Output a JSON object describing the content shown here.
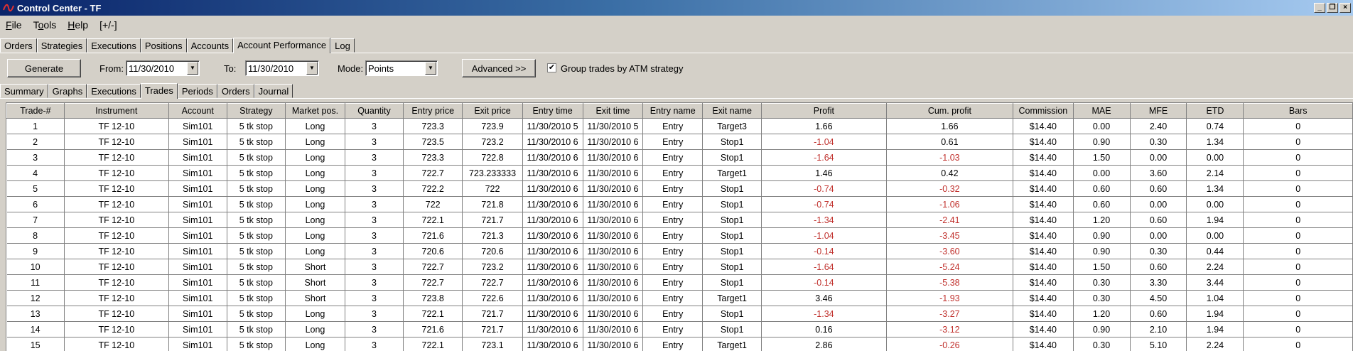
{
  "window": {
    "title": "Control Center - TF",
    "controls": [
      "_",
      "❒",
      "×"
    ]
  },
  "menu": [
    {
      "pre": "",
      "ul": "F",
      "post": "ile"
    },
    {
      "pre": "T",
      "ul": "o",
      "post": "ols"
    },
    {
      "pre": "",
      "ul": "H",
      "post": "elp"
    },
    {
      "pre": "",
      "ul": "",
      "post": "[+/-]"
    }
  ],
  "main_tabs": [
    "Orders",
    "Strategies",
    "Executions",
    "Positions",
    "Accounts",
    "Account Performance",
    "Log"
  ],
  "main_tab_active": 5,
  "toolbar": {
    "generate_label": "Generate",
    "from_label": "From:",
    "from_value": "11/30/2010",
    "to_label": "To:",
    "to_value": "11/30/2010",
    "mode_label": "Mode:",
    "mode_value": "Points",
    "advanced_label": "Advanced >>",
    "group_checked": true,
    "group_label": "Group trades by ATM strategy"
  },
  "sub_tabs": [
    "Summary",
    "Graphs",
    "Executions",
    "Trades",
    "Periods",
    "Orders",
    "Journal"
  ],
  "sub_tab_active": 3,
  "table": {
    "columns": [
      "Trade-#",
      "Instrument",
      "Account",
      "Strategy",
      "Market pos.",
      "Quantity",
      "Entry price",
      "Exit price",
      "Entry time",
      "Exit time",
      "Entry name",
      "Exit name",
      "Profit",
      "Cum. profit",
      "Commission",
      "MAE",
      "MFE",
      "ETD",
      "Bars"
    ],
    "rows": [
      [
        "1",
        "TF 12-10",
        "Sim101",
        "5 tk stop",
        "Long",
        "3",
        "723.3",
        "723.9",
        "11/30/2010 5",
        "11/30/2010 5",
        "Entry",
        "Target3",
        "1.66",
        "1.66",
        "$14.40",
        "0.00",
        "2.40",
        "0.74",
        "0"
      ],
      [
        "2",
        "TF 12-10",
        "Sim101",
        "5 tk stop",
        "Long",
        "3",
        "723.5",
        "723.2",
        "11/30/2010 6",
        "11/30/2010 6",
        "Entry",
        "Stop1",
        "-1.04",
        "0.61",
        "$14.40",
        "0.90",
        "0.30",
        "1.34",
        "0"
      ],
      [
        "3",
        "TF 12-10",
        "Sim101",
        "5 tk stop",
        "Long",
        "3",
        "723.3",
        "722.8",
        "11/30/2010 6",
        "11/30/2010 6",
        "Entry",
        "Stop1",
        "-1.64",
        "-1.03",
        "$14.40",
        "1.50",
        "0.00",
        "0.00",
        "0"
      ],
      [
        "4",
        "TF 12-10",
        "Sim101",
        "5 tk stop",
        "Long",
        "3",
        "722.7",
        "723.233333",
        "11/30/2010 6",
        "11/30/2010 6",
        "Entry",
        "Target1",
        "1.46",
        "0.42",
        "$14.40",
        "0.00",
        "3.60",
        "2.14",
        "0"
      ],
      [
        "5",
        "TF 12-10",
        "Sim101",
        "5 tk stop",
        "Long",
        "3",
        "722.2",
        "722",
        "11/30/2010 6",
        "11/30/2010 6",
        "Entry",
        "Stop1",
        "-0.74",
        "-0.32",
        "$14.40",
        "0.60",
        "0.60",
        "1.34",
        "0"
      ],
      [
        "6",
        "TF 12-10",
        "Sim101",
        "5 tk stop",
        "Long",
        "3",
        "722",
        "721.8",
        "11/30/2010 6",
        "11/30/2010 6",
        "Entry",
        "Stop1",
        "-0.74",
        "-1.06",
        "$14.40",
        "0.60",
        "0.00",
        "0.00",
        "0"
      ],
      [
        "7",
        "TF 12-10",
        "Sim101",
        "5 tk stop",
        "Long",
        "3",
        "722.1",
        "721.7",
        "11/30/2010 6",
        "11/30/2010 6",
        "Entry",
        "Stop1",
        "-1.34",
        "-2.41",
        "$14.40",
        "1.20",
        "0.60",
        "1.94",
        "0"
      ],
      [
        "8",
        "TF 12-10",
        "Sim101",
        "5 tk stop",
        "Long",
        "3",
        "721.6",
        "721.3",
        "11/30/2010 6",
        "11/30/2010 6",
        "Entry",
        "Stop1",
        "-1.04",
        "-3.45",
        "$14.40",
        "0.90",
        "0.00",
        "0.00",
        "0"
      ],
      [
        "9",
        "TF 12-10",
        "Sim101",
        "5 tk stop",
        "Long",
        "3",
        "720.6",
        "720.6",
        "11/30/2010 6",
        "11/30/2010 6",
        "Entry",
        "Stop1",
        "-0.14",
        "-3.60",
        "$14.40",
        "0.90",
        "0.30",
        "0.44",
        "0"
      ],
      [
        "10",
        "TF 12-10",
        "Sim101",
        "5 tk stop",
        "Short",
        "3",
        "722.7",
        "723.2",
        "11/30/2010 6",
        "11/30/2010 6",
        "Entry",
        "Stop1",
        "-1.64",
        "-5.24",
        "$14.40",
        "1.50",
        "0.60",
        "2.24",
        "0"
      ],
      [
        "11",
        "TF 12-10",
        "Sim101",
        "5 tk stop",
        "Short",
        "3",
        "722.7",
        "722.7",
        "11/30/2010 6",
        "11/30/2010 6",
        "Entry",
        "Stop1",
        "-0.14",
        "-5.38",
        "$14.40",
        "0.30",
        "3.30",
        "3.44",
        "0"
      ],
      [
        "12",
        "TF 12-10",
        "Sim101",
        "5 tk stop",
        "Short",
        "3",
        "723.8",
        "722.6",
        "11/30/2010 6",
        "11/30/2010 6",
        "Entry",
        "Target1",
        "3.46",
        "-1.93",
        "$14.40",
        "0.30",
        "4.50",
        "1.04",
        "0"
      ],
      [
        "13",
        "TF 12-10",
        "Sim101",
        "5 tk stop",
        "Long",
        "3",
        "722.1",
        "721.7",
        "11/30/2010 6",
        "11/30/2010 6",
        "Entry",
        "Stop1",
        "-1.34",
        "-3.27",
        "$14.40",
        "1.20",
        "0.60",
        "1.94",
        "0"
      ],
      [
        "14",
        "TF 12-10",
        "Sim101",
        "5 tk stop",
        "Long",
        "3",
        "721.6",
        "721.7",
        "11/30/2010 6",
        "11/30/2010 6",
        "Entry",
        "Stop1",
        "0.16",
        "-3.12",
        "$14.40",
        "0.90",
        "2.10",
        "1.94",
        "0"
      ],
      [
        "15",
        "TF 12-10",
        "Sim101",
        "5 tk stop",
        "Long",
        "3",
        "722.1",
        "723.1",
        "11/30/2010 6",
        "11/30/2010 6",
        "Entry",
        "Target1",
        "2.86",
        "-0.26",
        "$14.40",
        "0.30",
        "5.10",
        "2.24",
        "0"
      ]
    ]
  },
  "colors": {
    "negative": "#c0302c",
    "window_bg": "#d4d0c8"
  }
}
